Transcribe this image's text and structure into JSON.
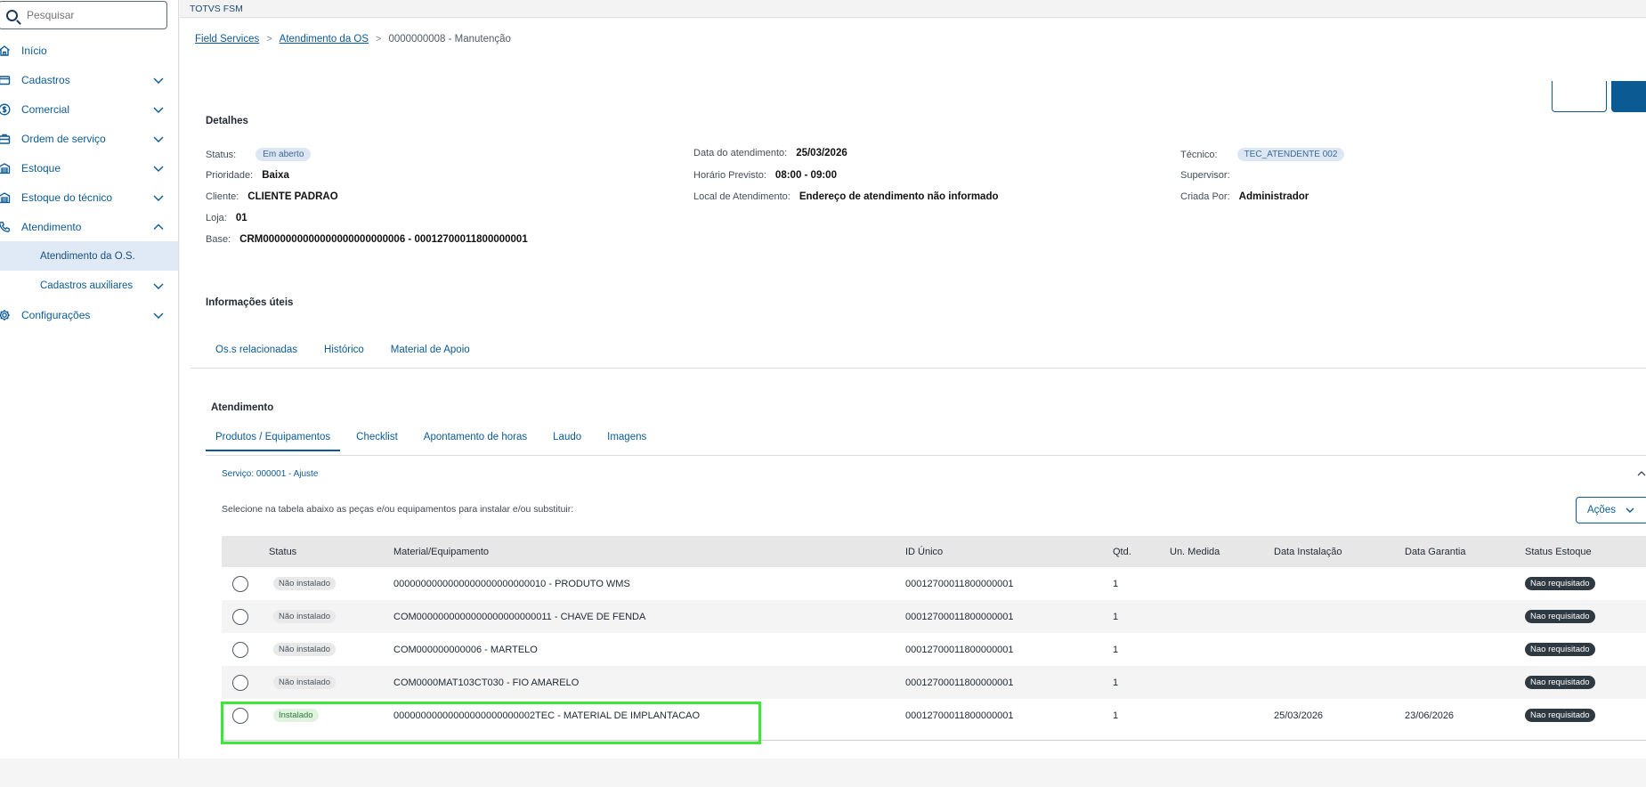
{
  "search": {
    "placeholder": "Pesquisar"
  },
  "sidebar": {
    "items": [
      {
        "label": "Início"
      },
      {
        "label": "Cadastros"
      },
      {
        "label": "Comercial"
      },
      {
        "label": "Ordem de serviço"
      },
      {
        "label": "Estoque"
      },
      {
        "label": "Estoque do técnico"
      },
      {
        "label": "Atendimento"
      },
      {
        "label": "Atendimento da O.S."
      },
      {
        "label": "Cadastros auxiliares"
      },
      {
        "label": "Configurações"
      }
    ]
  },
  "topbar": {
    "title": "TOTVS FSM"
  },
  "breadcrumb": {
    "root": "Field Services",
    "parent": "Atendimento da OS",
    "current": "0000000008 - Manutenção"
  },
  "details": {
    "title": "Detalhes",
    "status_label": "Status:",
    "status_value": "Em aberto",
    "prioridade_label": "Prioridade:",
    "prioridade_value": "Baixa",
    "cliente_label": "Cliente:",
    "cliente_value": "CLIENTE PADRAO",
    "loja_label": "Loja:",
    "loja_value": "01",
    "base_label": "Base:",
    "base_value": "CRM0000000000000000000000006 - 00012700011800000001",
    "data_label": "Data do atendimento:",
    "data_value": "25/03/2026",
    "horario_label": "Horário Previsto:",
    "horario_value": "08:00 - 09:00",
    "local_label": "Local de Atendimento:",
    "local_value": "Endereço de atendimento não informado",
    "tecnico_label": "Técnico:",
    "tecnico_value": "TEC_ATENDENTE 002",
    "supervisor_label": "Supervisor:",
    "criada_label": "Criada Por:",
    "criada_value": "Administrador"
  },
  "info": {
    "title": "Informações úteis",
    "tabs": [
      "Os.s relacionadas",
      "Histórico",
      "Material de Apoio"
    ]
  },
  "atendimento": {
    "title": "Atendimento",
    "tabs": [
      "Produtos / Equipamentos",
      "Checklist",
      "Apontamento de horas",
      "Laudo",
      "Imagens"
    ],
    "service_label": "Serviço: 000001 - Ajuste",
    "instructions": "Selecione na tabela abaixo as peças e/ou equipamentos para instalar e/ou substituir:",
    "acoes_label": "Ações"
  },
  "table": {
    "headers": [
      "Status",
      "Material/Equipamento",
      "ID Único",
      "Qtd.",
      "Un. Medida",
      "Data Instalação",
      "Data Garantia",
      "Status Estoque"
    ],
    "rows": [
      {
        "status": "Não instalado",
        "material": "0000000000000000000000000010 - PRODUTO WMS",
        "id": "00012700011800000001",
        "qtd": "1",
        "un": "",
        "data_inst": "",
        "data_gar": "",
        "estoque": "Nao requisitado"
      },
      {
        "status": "Não instalado",
        "material": "COM0000000000000000000000011 - CHAVE DE FENDA",
        "id": "00012700011800000001",
        "qtd": "1",
        "un": "",
        "data_inst": "",
        "data_gar": "",
        "estoque": "Nao requisitado"
      },
      {
        "status": "Não instalado",
        "material": "COM000000000006 - MARTELO",
        "id": "00012700011800000001",
        "qtd": "1",
        "un": "",
        "data_inst": "",
        "data_gar": "",
        "estoque": "Nao requisitado"
      },
      {
        "status": "Não instalado",
        "material": "COM0000MAT103CT030 - FIO AMARELO",
        "id": "00012700011800000001",
        "qtd": "1",
        "un": "",
        "data_inst": "",
        "data_gar": "",
        "estoque": "Nao requisitado"
      },
      {
        "status": "Instalado",
        "material": "00000000000000000000000002TEC - MATERIAL DE IMPLANTACAO",
        "id": "00012700011800000001",
        "qtd": "1",
        "un": "",
        "data_inst": "25/03/2026",
        "data_gar": "23/06/2026",
        "estoque": "Nao requisitado"
      }
    ]
  },
  "colors": {
    "accent": "#0c5a94",
    "highlight": "#3ee63a",
    "active_nav_bg": "#dfeaf6"
  }
}
